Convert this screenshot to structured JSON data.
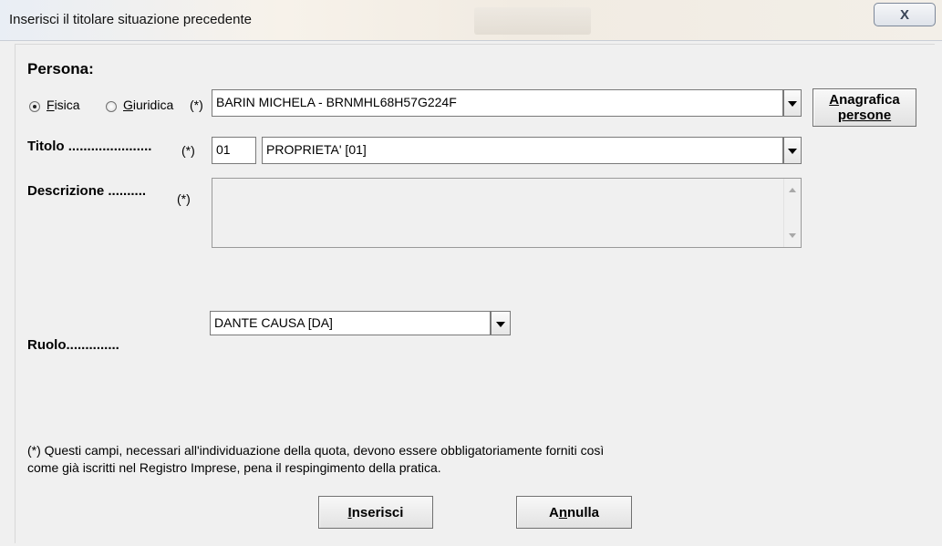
{
  "window": {
    "title": "Inserisci il titolare situazione precedente",
    "close_label": "X"
  },
  "persona": {
    "heading": "Persona:",
    "options": [
      {
        "label_first": "F",
        "label_rest": "isica",
        "selected": true
      },
      {
        "label_first": "G",
        "label_rest": "iuridica",
        "selected": false
      }
    ],
    "required_mark": "(*)",
    "value": "BARIN MICHELA - BRNMHL68H57G224F",
    "anagrafica_button": {
      "first": "A",
      "line1_rest": "nagrafica",
      "line2": "persone"
    }
  },
  "titolo": {
    "label": "Titolo ......................",
    "required_mark": "(*)",
    "code": "01",
    "value": "PROPRIETA' [01]"
  },
  "descrizione": {
    "label": "Descrizione ..........",
    "required_mark": "(*)",
    "value": ""
  },
  "ruolo": {
    "label": "Ruolo..............",
    "value": "DANTE CAUSA [DA]"
  },
  "note": {
    "line1": "(*) Questi campi, necessari all'individuazione della quota, devono essere obbligatoriamente forniti così",
    "line2": "come già iscritti nel Registro Imprese, pena il respingimento della pratica."
  },
  "buttons": {
    "insert": {
      "first": "I",
      "rest": "nserisci"
    },
    "cancel": {
      "before": "A",
      "ul": "n",
      "after": "nulla"
    }
  }
}
